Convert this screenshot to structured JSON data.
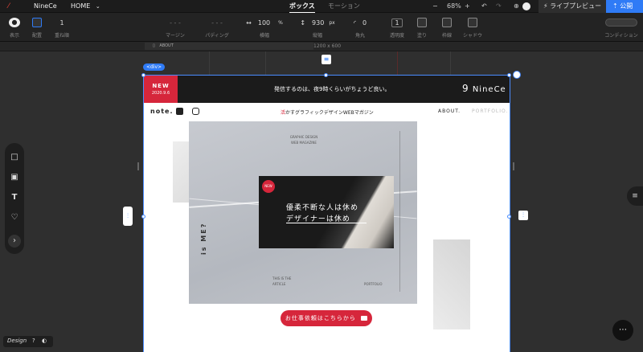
{
  "app": {
    "brand": "NineCe",
    "page_select": "HOME"
  },
  "tabs": [
    {
      "label": "ボックス"
    },
    {
      "label": "モーション"
    }
  ],
  "zoom": "68%",
  "actions": {
    "preview": "ライブプレビュー",
    "publish": "公開"
  },
  "toolbar": {
    "display_label": "表示",
    "layout_label": "配置",
    "stack_value": "1",
    "stack_label": "重ね順",
    "margin_label": "マージン",
    "padding_label": "パディング",
    "width_value": "100",
    "width_unit": "%",
    "width_label": "横幅",
    "height_value": "930",
    "height_unit": "px",
    "height_label": "縦幅",
    "radius_value": "0",
    "radius_label": "角丸",
    "opacity_value": "1",
    "opacity_label": "透明度",
    "fill_label": "塗り",
    "border_label": "枠線",
    "shadow_label": "シャドウ",
    "condition_label": "コンディション"
  },
  "canvas": {
    "page_tab": "ABOUT",
    "size_readout": "1200 x 600",
    "element_tag": "<div>"
  },
  "site": {
    "banner_badge": "NEW",
    "banner_date": "2020.9.6",
    "banner_text": "発信するのは、夜9時くらいがちょうど良い。",
    "logo": "NineCe",
    "nav_logo": "note.",
    "tagline_accent": "活",
    "tagline_rest": "かすグラフィックデザインWEBマガジン",
    "nav_about": "ABOUT.",
    "nav_portfolio": "PORTFOLIO.",
    "hero_small_title": "GRAPHIC DESIGN WEB MAGAZINE",
    "hero_vertical_left": "is ME?",
    "hero_side_text": "THIS IS THE ARTICLE",
    "hero_portfolio": "PORTFOLIO",
    "hero_card_badge": "NEW",
    "hero_card_line1": "優柔不断な人は休め",
    "hero_card_line2": "デザイナーは休め",
    "cta_label": "お仕事依頼はこちらから"
  },
  "statusbar": {
    "label": "Design"
  },
  "colors": {
    "accent": "#2f7bf6",
    "brand_red": "#d6263b",
    "dark": "#1b1b1b"
  }
}
